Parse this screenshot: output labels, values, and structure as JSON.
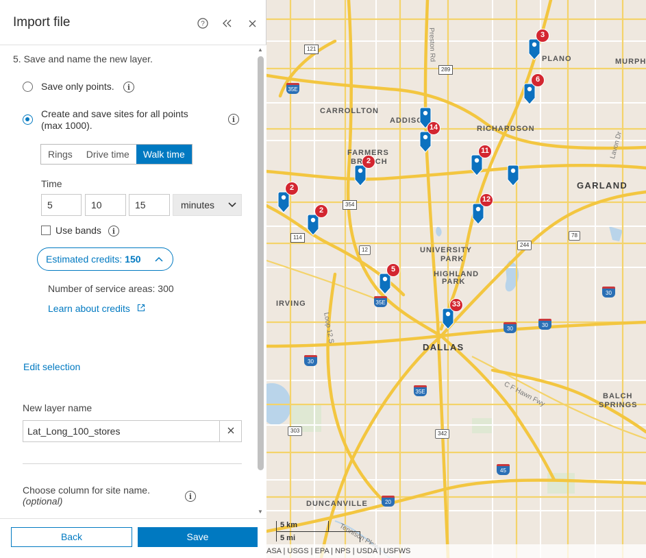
{
  "panel": {
    "title": "Import file",
    "help_icon": "help-circle-icon",
    "collapse_icon": "chevrons-left-icon",
    "close_icon": "close-icon",
    "step_text": "5.  Save and name the new layer.",
    "option_points_label": "Save only points.",
    "option_sites_label_line1": "Create and save sites for all points",
    "option_sites_label_line2": "(max 1000).",
    "selected_option": "sites",
    "tabs": [
      {
        "label": "Rings",
        "active": false
      },
      {
        "label": "Drive time",
        "active": false
      },
      {
        "label": "Walk time",
        "active": true
      }
    ],
    "time_label": "Time",
    "time_values": [
      "5",
      "10",
      "15"
    ],
    "time_unit": "minutes",
    "use_bands_label": "Use bands",
    "use_bands_checked": false,
    "credits_label": "Estimated credits: ",
    "credits_value": "150",
    "service_areas_label": "Number of service areas: ",
    "service_areas_value": "300",
    "learn_link": "Learn about credits",
    "edit_selection": "Edit selection",
    "layer_name_label": "New layer name",
    "layer_name_value": "Lat_Long_100_stores",
    "site_column_label": "Choose column for site name.",
    "site_column_optional": "(optional)",
    "back_button": "Back",
    "save_button": "Save",
    "accent_color": "#0079c1"
  },
  "map": {
    "places": [
      "CARROLLTON",
      "FARMERS",
      "BRANCH",
      "ADDISON",
      "RICHARDSON",
      "GARLAND",
      "UNIVERSITY",
      "PARK",
      "HIGHLAND",
      "PARK",
      "IRVING",
      "DALLAS",
      "BALCH",
      "SPRINGS",
      "DUNCANVILLE",
      "MURPH",
      "PLANO"
    ],
    "road_labels": [
      "Preston Rd",
      "Lavon Dr",
      "Loop 12 S",
      "C F Hawn Fwy",
      "Tennison Pkwy"
    ],
    "route_shields": [
      "121",
      "289",
      "35E",
      "354",
      "114",
      "12",
      "244",
      "78",
      "30",
      "30",
      "30",
      "30",
      "35E",
      "35E",
      "303",
      "342",
      "45",
      "20"
    ],
    "clusters": [
      "3",
      "6",
      "14",
      "2",
      "11",
      "2",
      "2",
      "12",
      "5",
      "33"
    ],
    "pin_color": "#0c71bf",
    "badge_color": "#d32630",
    "scale_km": "5 km",
    "scale_mi": "5 mi",
    "attribution": "ASA | USGS | EPA | NPS | USDA | USFWS"
  }
}
